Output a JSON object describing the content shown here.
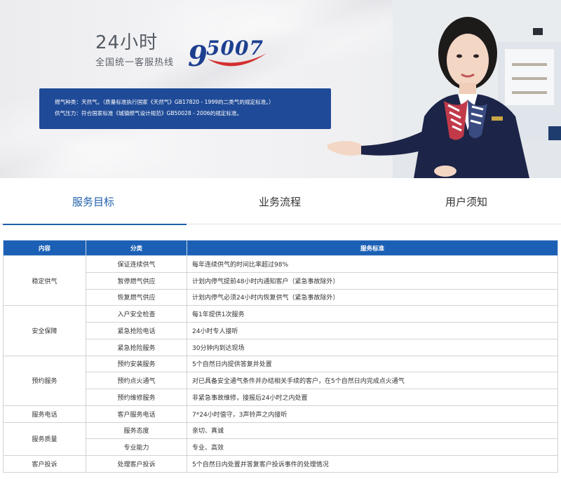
{
  "banner": {
    "hotline_big": "24小时",
    "hotline_small": "全国统一客服热线",
    "hotline_number": "95007",
    "colors": {
      "brand_blue": "#1d3f8f",
      "brand_red": "#d32f2f",
      "notice_bg": "#1f4a97"
    },
    "notice_line1": "燃气种类：天然气。（质量标准执行国家《天然气》GB17820 - 1999的二类气的规定标准。）",
    "notice_line2": "供气压力：符合国家标准《城镇燃气设计规范》GB50028 - 2006的规定标准。"
  },
  "tabs": [
    {
      "label": "服务目标",
      "active": true
    },
    {
      "label": "业务流程",
      "active": false
    },
    {
      "label": "用户须知",
      "active": false
    }
  ],
  "table": {
    "header_color": "#1b60b5",
    "headers": [
      "内容",
      "分类",
      "服务标准"
    ],
    "groups": [
      {
        "content": "稳定供气",
        "rows": [
          {
            "category": "保证连续供气",
            "standard": "每年连续供气的时间比率超过98%"
          },
          {
            "category": "暂停燃气供应",
            "standard": "计划内停气提前48小时内通知客户（紧急事故除外）"
          },
          {
            "category": "恢复燃气供应",
            "standard": "计划内停气必须24小时内恢复供气（紧急事故除外）"
          }
        ]
      },
      {
        "content": "安全保障",
        "rows": [
          {
            "category": "入户安全检查",
            "standard": "每1年提供1次服务"
          },
          {
            "category": "紧急抢险电话",
            "standard": "24小时专人接听"
          },
          {
            "category": "紧急抢险服务",
            "standard": "30分钟内到达现场"
          }
        ]
      },
      {
        "content": "预约服务",
        "rows": [
          {
            "category": "预约安装服务",
            "standard": "5个自然日内提供答复并处置"
          },
          {
            "category": "预约点火通气",
            "standard": "对已具备安全通气条件并办结相关手续的客户，在5个自然日内完成点火通气"
          },
          {
            "category": "预约维修服务",
            "standard": "非紧急事故维修，接报后24小时之内处置"
          }
        ]
      },
      {
        "content": "服务电话",
        "rows": [
          {
            "category": "客户服务电话",
            "standard": "7*24小时值守，3声铃声之内接听"
          }
        ]
      },
      {
        "content": "服务质量",
        "rows": [
          {
            "category": "服务态度",
            "standard": "亲切、真诚"
          },
          {
            "category": "专业能力",
            "standard": "专业、高效"
          }
        ]
      },
      {
        "content": "客户投诉",
        "rows": [
          {
            "category": "处理客户投诉",
            "standard": "5个自然日内处置并答复客户投诉事件的处理情况"
          }
        ]
      }
    ]
  }
}
